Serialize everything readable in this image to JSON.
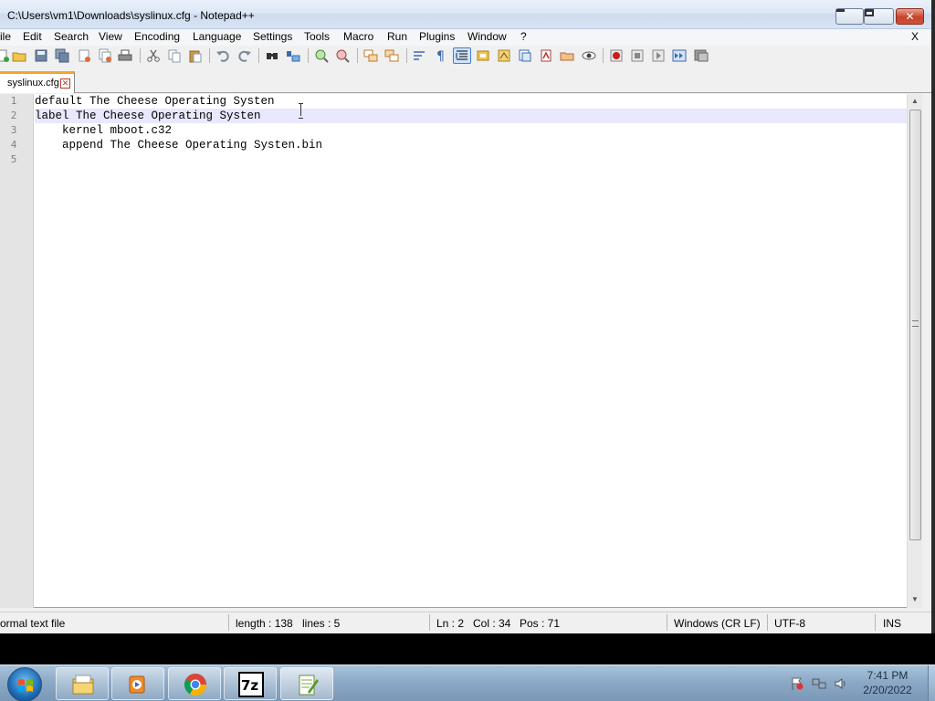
{
  "window": {
    "title": "C:\\Users\\vm1\\Downloads\\syslinux.cfg - Notepad++"
  },
  "menu": {
    "items": [
      "ile",
      "Edit",
      "Search",
      "View",
      "Encoding",
      "Language",
      "Settings",
      "Tools",
      "Macro",
      "Run",
      "Plugins",
      "Window",
      "?"
    ],
    "close_label": "X"
  },
  "toolbar": {
    "icons": [
      "new-file-icon",
      "open-file-icon",
      "save-icon",
      "save-all-icon",
      "close-icon",
      "close-all-icon",
      "print-icon",
      "cut-icon",
      "copy-icon",
      "paste-icon",
      "undo-icon",
      "redo-icon",
      "find-icon",
      "replace-icon",
      "zoom-in-icon",
      "zoom-out-icon",
      "sync-vertical-icon",
      "sync-horizontal-icon",
      "word-wrap-icon",
      "show-all-chars-icon",
      "indent-guide-icon",
      "doc-map-icon",
      "function-list-icon",
      "folder-workspace-icon",
      "document-list-icon",
      "clipboard-history-icon",
      "folder-icon",
      "monitoring-icon",
      "record-macro-icon",
      "stop-macro-icon",
      "play-macro-icon",
      "run-macro-multiple-icon",
      "save-macro-icon"
    ]
  },
  "tab": {
    "label": "syslinux.cfg",
    "close_glyph": "✕"
  },
  "editor": {
    "line_numbers": [
      "1",
      "2",
      "3",
      "4",
      "5"
    ],
    "lines": [
      "default The Cheese Operating Systen",
      "label The Cheese Operating Systen",
      "    kernel mboot.c32",
      "    append The Cheese Operating Systen.bin",
      ""
    ],
    "current_line": 2
  },
  "statusbar": {
    "file_type": "ormal text file",
    "length": "length : 138",
    "lines": "lines : 5",
    "ln": "Ln : 2",
    "col": "Col : 34",
    "pos": "Pos : 71",
    "eol": "Windows (CR LF)",
    "encoding": "UTF-8",
    "ins": "INS"
  },
  "taskbar": {
    "apps": [
      "file-explorer-icon",
      "media-player-icon",
      "chrome-icon",
      "7zip-icon",
      "notepad-plus-plus-icon"
    ],
    "seven_zip_label": "7z",
    "clock_time": "7:41 PM",
    "clock_date": "2/20/2022"
  },
  "colors": {
    "current_line": "#e8e8ff",
    "tab_accent": "#f7a428",
    "gutter": "#e4e4e4"
  }
}
